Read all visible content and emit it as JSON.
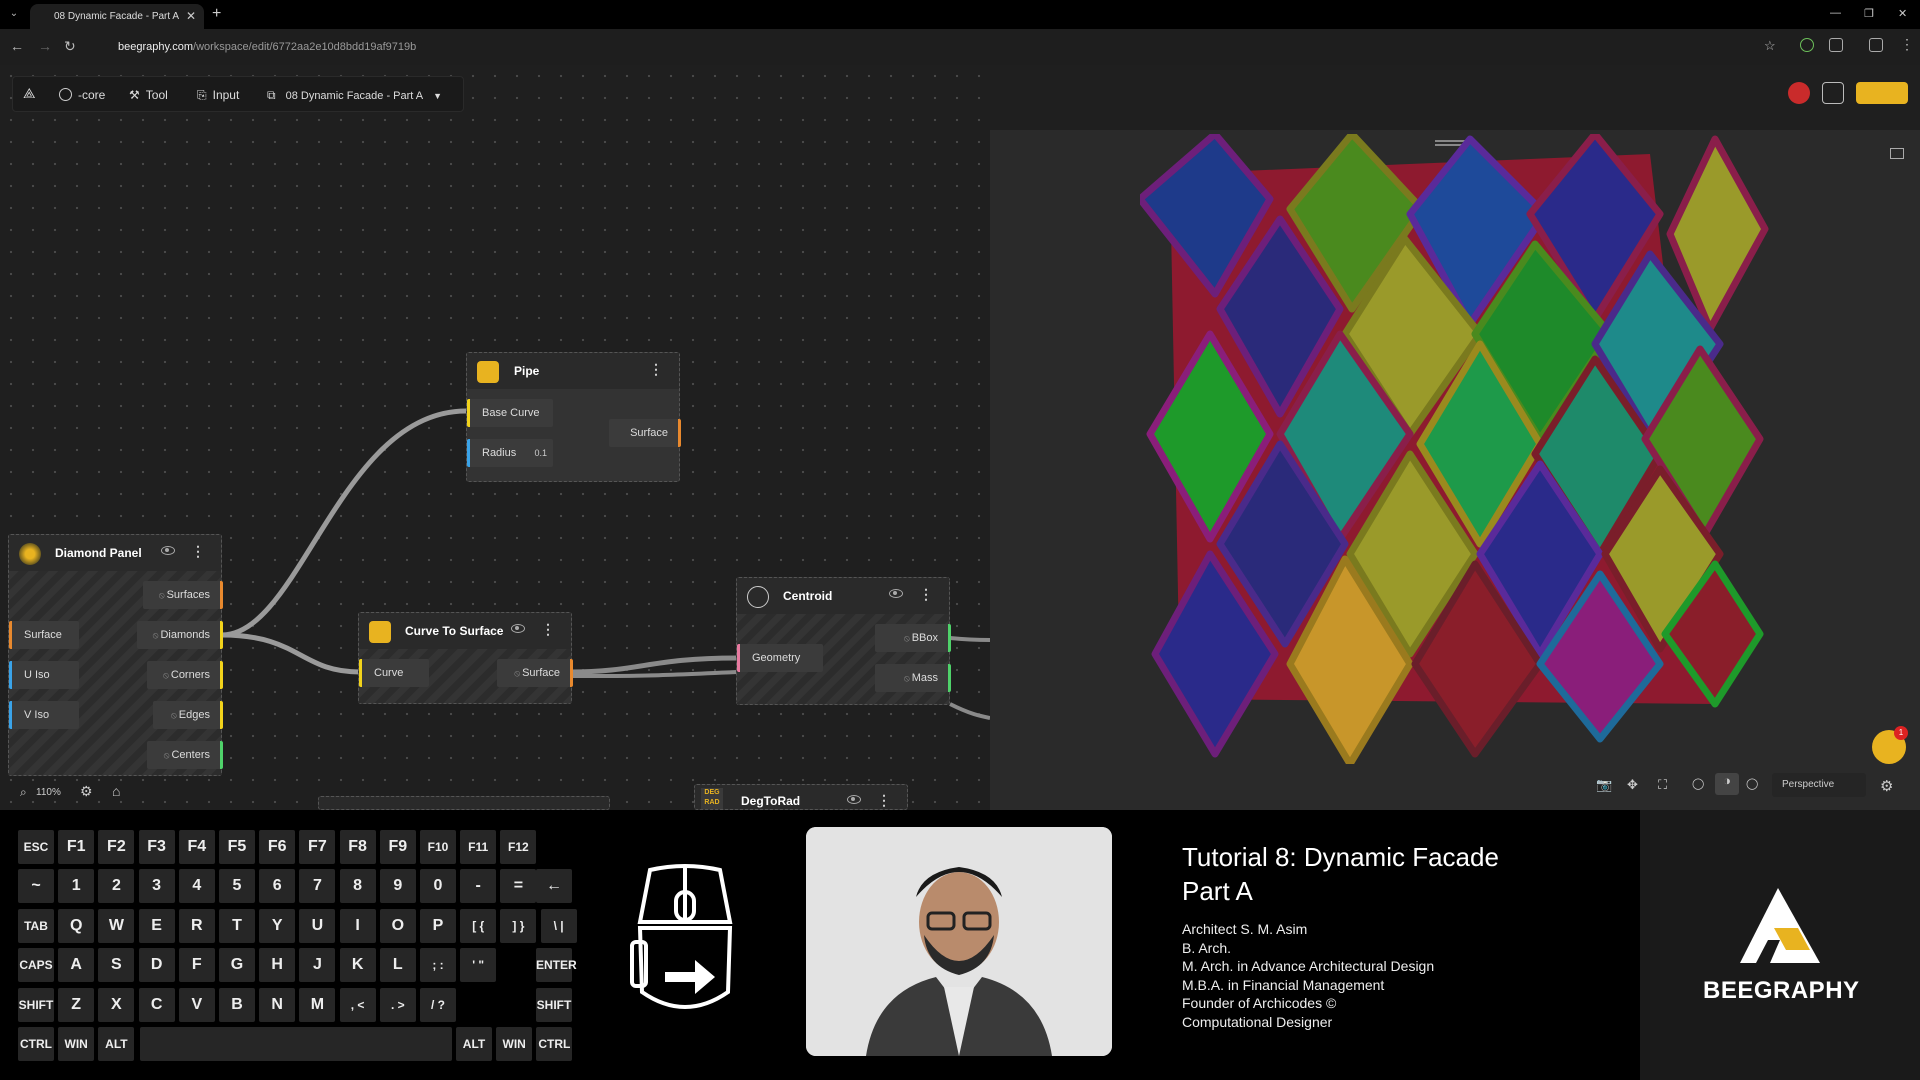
{
  "browser": {
    "tab_title": "08 Dynamic Facade - Part A",
    "url_host": "beegraphy.com",
    "url_path": "/workspace/edit/6772aa2e10d8bdd19af9719b"
  },
  "toolbar": {
    "core": "-core",
    "tool": "Tool",
    "input": "Input",
    "project": "08 Dynamic Facade - Part A"
  },
  "nodes": {
    "pipe": {
      "title": "Pipe",
      "base_curve": "Base Curve",
      "radius": "Radius",
      "radius_value": "0.1",
      "surface": "Surface"
    },
    "diamond_panel": {
      "title": "Diamond Panel",
      "inputs": [
        "Surface",
        "U Iso",
        "V Iso"
      ],
      "outputs": [
        "Surfaces",
        "Diamonds",
        "Corners",
        "Edges",
        "Centers"
      ]
    },
    "curve_to_surface": {
      "title": "Curve To Surface",
      "input": "Curve",
      "output": "Surface"
    },
    "centroid": {
      "title": "Centroid",
      "input": "Geometry",
      "outputs": [
        "BBox",
        "Mass"
      ]
    },
    "degtorad": {
      "title": "DegToRad",
      "badge": "DEG RAD"
    }
  },
  "canvas": {
    "zoom": "110%"
  },
  "viewport": {
    "projection": "Perspective",
    "notification_count": "1"
  },
  "keyboard": {
    "row1": [
      "ESC",
      "F1",
      "F2",
      "F3",
      "F4",
      "F5",
      "F6",
      "F7",
      "F8",
      "F9",
      "F10",
      "F11",
      "F12"
    ],
    "row2": [
      "~",
      "1",
      "2",
      "3",
      "4",
      "5",
      "6",
      "7",
      "8",
      "9",
      "0",
      "-",
      "="
    ],
    "row3": [
      "TAB",
      "Q",
      "W",
      "E",
      "R",
      "T",
      "Y",
      "U",
      "I",
      "O",
      "P",
      "[ {",
      "] }",
      "\\ |"
    ],
    "row4": [
      "CAPS",
      "A",
      "S",
      "D",
      "F",
      "G",
      "H",
      "J",
      "K",
      "L",
      "; :",
      "' \""
    ],
    "row4_enter": "ENTER",
    "row5": [
      "SHIFT",
      "Z",
      "X",
      "C",
      "V",
      "B",
      "N",
      "M",
      ", <",
      ". >",
      "/ ?"
    ],
    "row5_shift": "SHIFT",
    "row6_left": [
      "CTRL",
      "WIN",
      "ALT"
    ],
    "row6_right": [
      "ALT",
      "WIN",
      "CTRL"
    ]
  },
  "credits": {
    "title_line1": "Tutorial 8: Dynamic Facade",
    "title_line2": "Part A",
    "lines": [
      "Architect S. M. Asim",
      "B. Arch.",
      "M. Arch. in Advance Architectural Design",
      "M.B.A. in Financial Management",
      "Founder of Archicodes ©",
      "Computational Designer"
    ]
  },
  "brand": {
    "name": "BEEGRAPHY"
  },
  "colors": {
    "accent": "#e8b320",
    "port_yellow": "#f2d31b",
    "port_blue": "#3aa3e8",
    "port_orange": "#e8892e",
    "port_green": "#4fd26a",
    "port_pink": "#e87aa0"
  }
}
